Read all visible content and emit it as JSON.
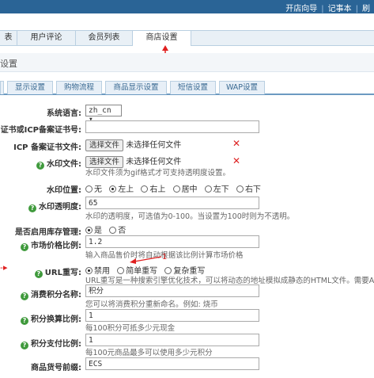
{
  "topbar": {
    "links": [
      "开店向导",
      "记事本",
      "刷"
    ]
  },
  "mainnav": {
    "tabs": [
      {
        "label": "表"
      },
      {
        "label": "用户评论"
      },
      {
        "label": "会员列表"
      },
      {
        "label": "商店设置"
      }
    ]
  },
  "annotation": {
    "tab_marker": "1",
    "url_marker": "1"
  },
  "titlebar": {
    "title": "设置"
  },
  "subtabs": [
    {
      "label": "显示设置"
    },
    {
      "label": "购物流程"
    },
    {
      "label": "商品显示设置"
    },
    {
      "label": "短信设置"
    },
    {
      "label": "WAP设置"
    }
  ],
  "form": {
    "lang": {
      "label": "系统语言:",
      "value": "zh_cn ▾"
    },
    "icp_no": {
      "label": "证书或ICP备案证书号:",
      "value": ""
    },
    "icp_file": {
      "label": "ICP 备案证书文件:",
      "button": "选择文件",
      "status": "未选择任何文件"
    },
    "watermark": {
      "label": "水印文件:",
      "button": "选择文件",
      "status": "未选择任何文件",
      "note": "水印文件须为gif格式才可支持透明度设置。"
    },
    "wm_pos": {
      "label": "水印位置:",
      "options": [
        "无",
        "左上",
        "右上",
        "居中",
        "左下",
        "右下"
      ],
      "selected": 1
    },
    "wm_alpha": {
      "label": "水印透明度:",
      "value": "65",
      "note": "水印的透明度，可选值为0-100。当设置为100时则为不透明。"
    },
    "stock": {
      "label": "是否启用库存管理:",
      "options": [
        "是",
        "否"
      ],
      "selected": 0
    },
    "market_price": {
      "label": "市场价格比例:",
      "value": "1.2",
      "note": "输入商品售价时将自动根据该比例计算市场价格"
    },
    "url_rewrite": {
      "label": "URL重写:",
      "options": [
        "禁用",
        "简单重写",
        "复杂重写"
      ],
      "selected": 0,
      "note": "URL重写是一种搜索引擎优化技术，可以将动态的地址模拟成静态的HTML文件。需要Apa"
    },
    "points_name": {
      "label": "消费积分名称:",
      "value": "积分",
      "note": "您可以将消费积分重新命名。例如: 烧币"
    },
    "points_rate": {
      "label": "积分换算比例:",
      "value": "1",
      "note": "每100积分可抵多少元现金"
    },
    "points_pay": {
      "label": "积分支付比例:",
      "value": "1",
      "note": "每100元商品最多可以使用多少元积分"
    },
    "sn_prefix": {
      "label": "商品货号前缀:",
      "value": "ECS"
    }
  }
}
